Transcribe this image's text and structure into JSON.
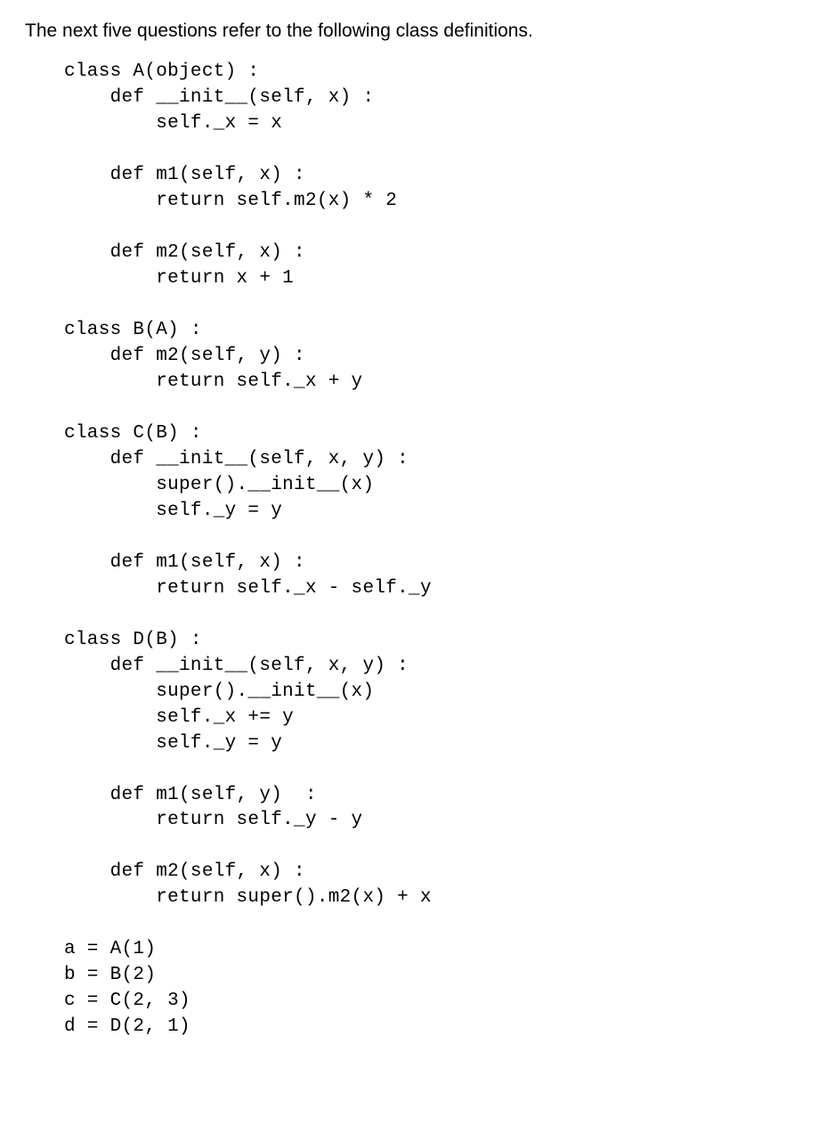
{
  "intro": "The next five questions refer to the following class definitions.",
  "code": "class A(object) :\n    def __init__(self, x) :\n        self._x = x\n\n    def m1(self, x) :\n        return self.m2(x) * 2\n\n    def m2(self, x) :\n        return x + 1\n\nclass B(A) :\n    def m2(self, y) :\n        return self._x + y\n\nclass C(B) :\n    def __init__(self, x, y) :\n        super().__init__(x)\n        self._y = y\n\n    def m1(self, x) :\n        return self._x - self._y\n\nclass D(B) :\n    def __init__(self, x, y) :\n        super().__init__(x)\n        self._x += y\n        self._y = y\n\n    def m1(self, y)  :\n        return self._y - y\n\n    def m2(self, x) :\n        return super().m2(x) + x\n\na = A(1)\nb = B(2)\nc = C(2, 3)\nd = D(2, 1)"
}
